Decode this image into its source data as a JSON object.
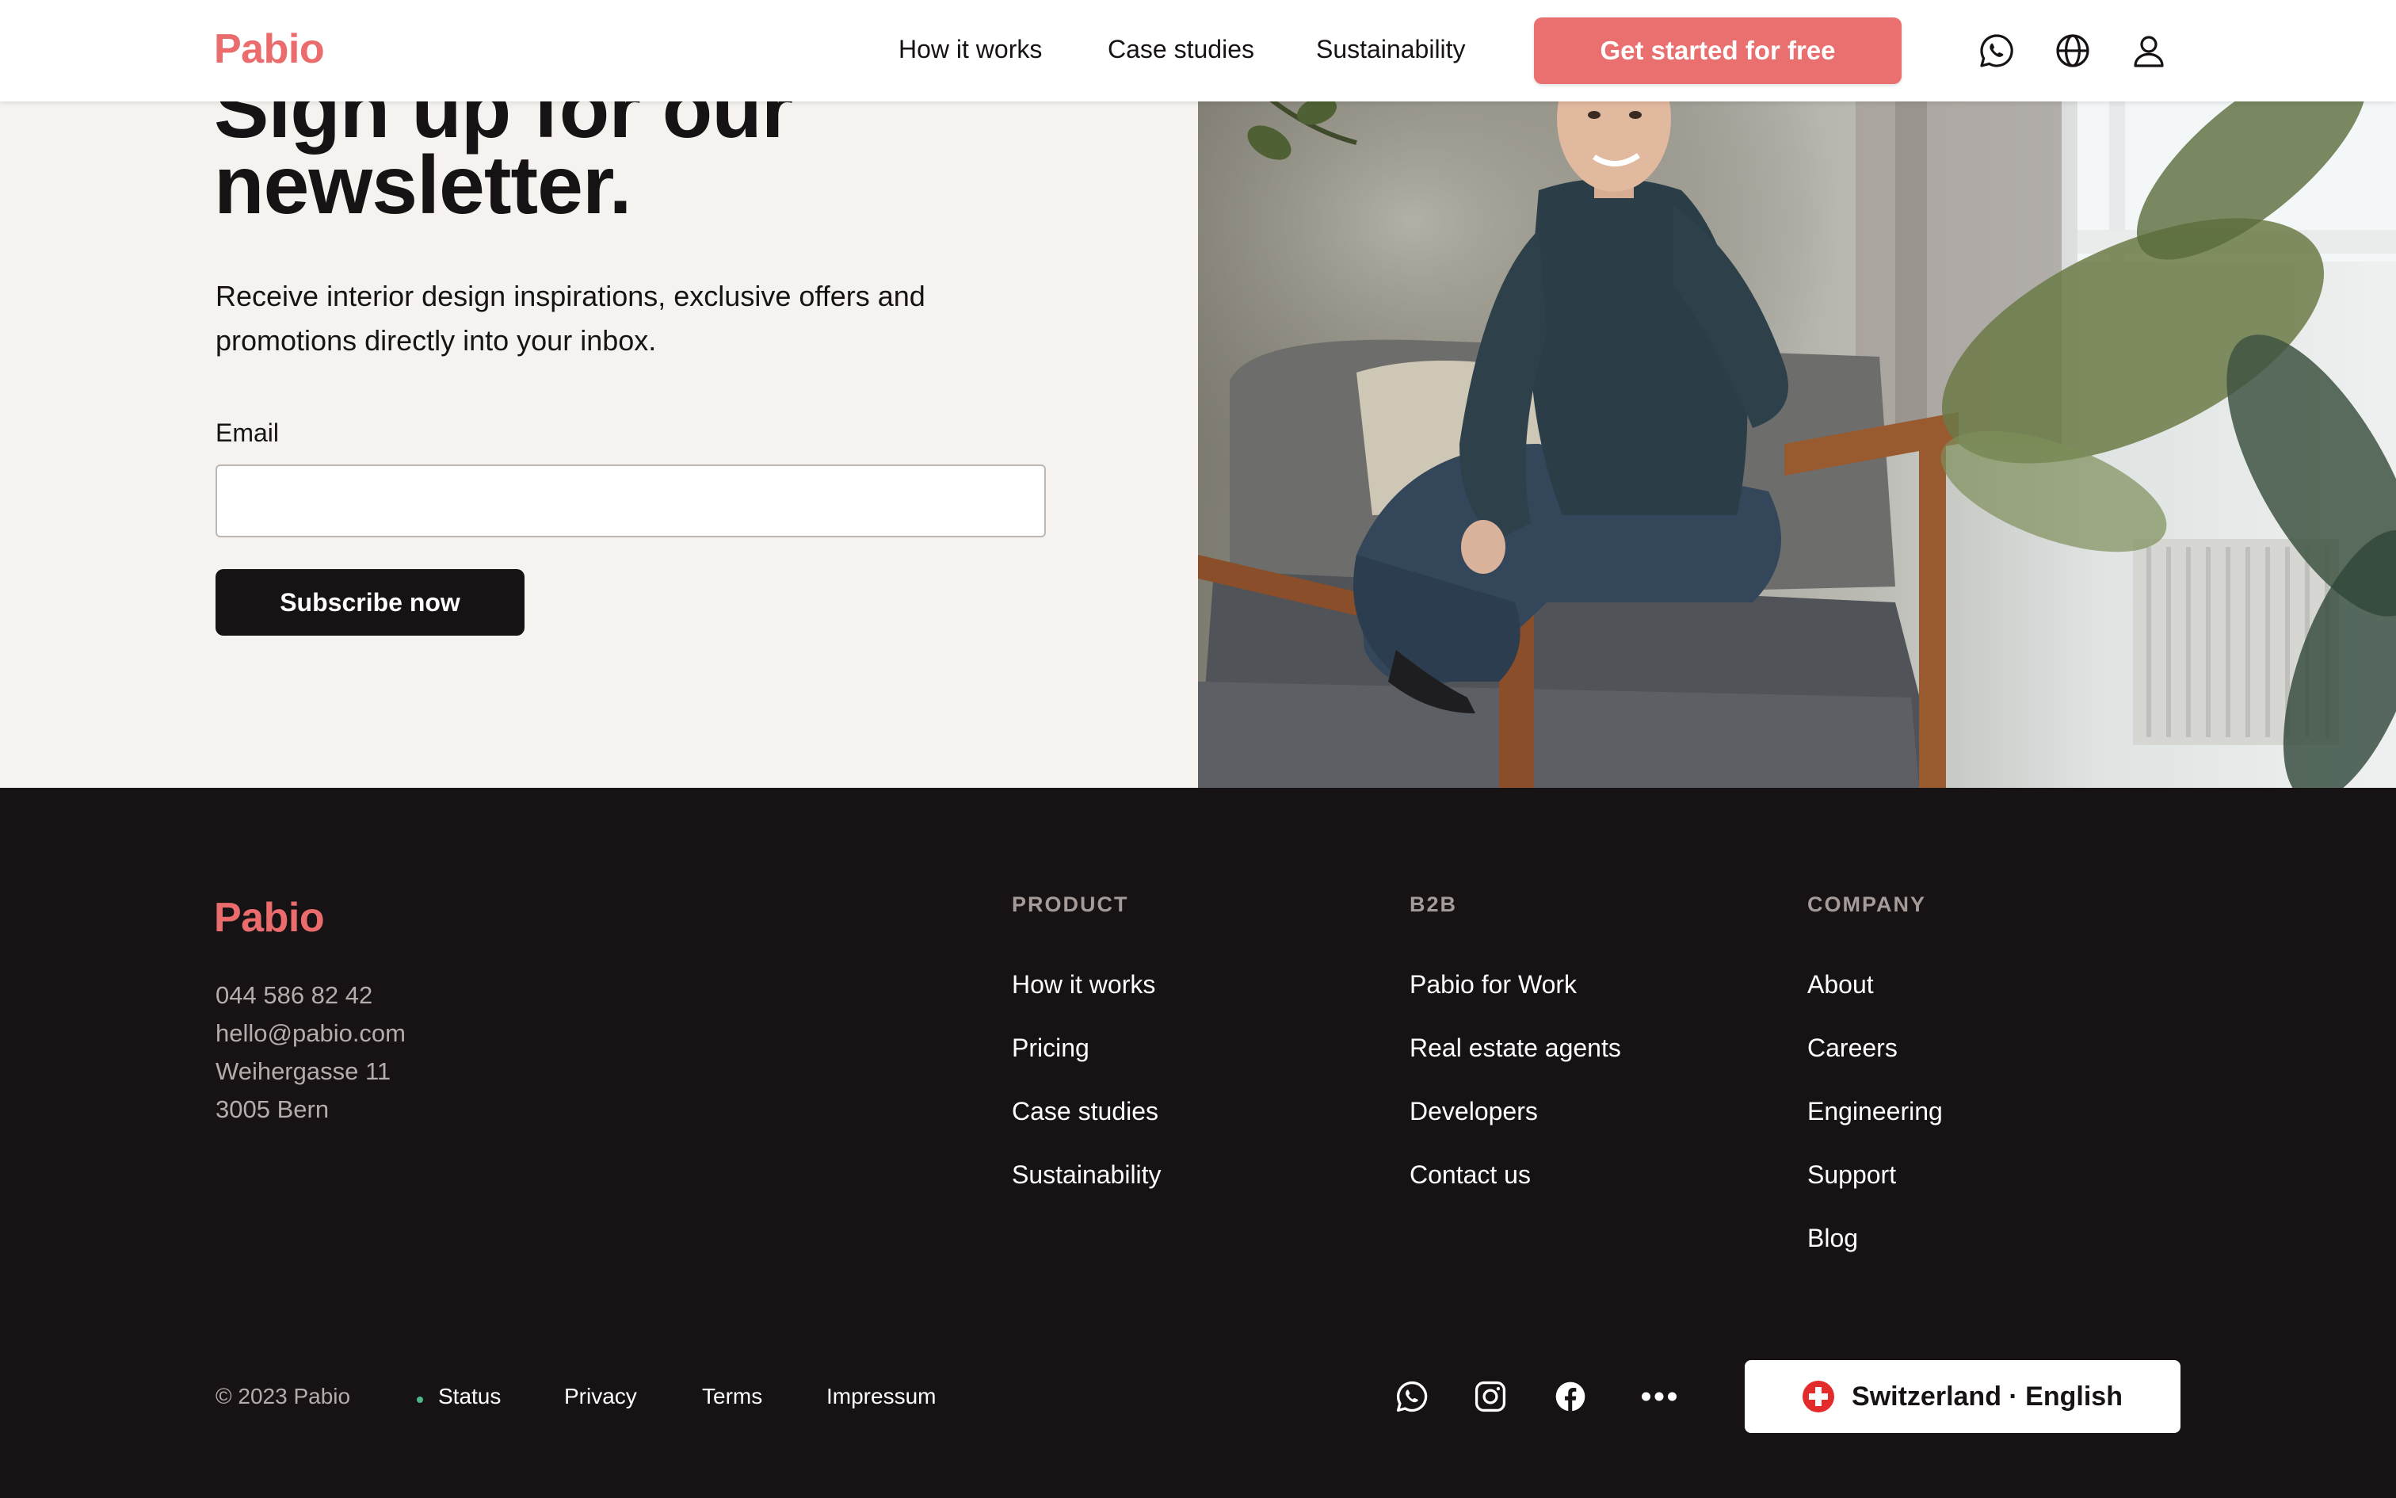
{
  "colors": {
    "brand": "#ea6c6c",
    "cta": "#ea7070",
    "dark": "#171213",
    "cream": "#f5f2ef",
    "status_ok": "#4fb786"
  },
  "header": {
    "logo": "Pabio",
    "nav": [
      "How it works",
      "Case studies",
      "Sustainability"
    ],
    "cta_label": "Get started for free",
    "icons": [
      "whatsapp-icon",
      "globe-icon",
      "user-icon"
    ]
  },
  "newsletter": {
    "title": "Sign up for our newsletter.",
    "description": "Receive interior design inspirations, exclusive offers and promotions directly into your inbox.",
    "email_label": "Email",
    "email_value": "",
    "email_placeholder": "",
    "subscribe_label": "Subscribe now"
  },
  "footer": {
    "logo": "Pabio",
    "contact": {
      "phone": "044 586 82 42",
      "email": "hello@pabio.com",
      "street": "Weihergasse 11",
      "city": "3005 Bern"
    },
    "columns": [
      {
        "heading": "PRODUCT",
        "links": [
          "How it works",
          "Pricing",
          "Case studies",
          "Sustainability"
        ]
      },
      {
        "heading": "B2B",
        "links": [
          "Pabio for Work",
          "Real estate agents",
          "Developers",
          "Contact us"
        ]
      },
      {
        "heading": "COMPANY",
        "links": [
          "About",
          "Careers",
          "Engineering",
          "Support",
          "Blog"
        ]
      }
    ],
    "copyright": "© 2023 Pabio",
    "bottom_links": [
      "Status",
      "Privacy",
      "Terms",
      "Impressum"
    ],
    "social_icons": [
      "whatsapp-icon",
      "instagram-icon",
      "facebook-icon",
      "more-icon"
    ],
    "locale": "Switzerland · English"
  }
}
